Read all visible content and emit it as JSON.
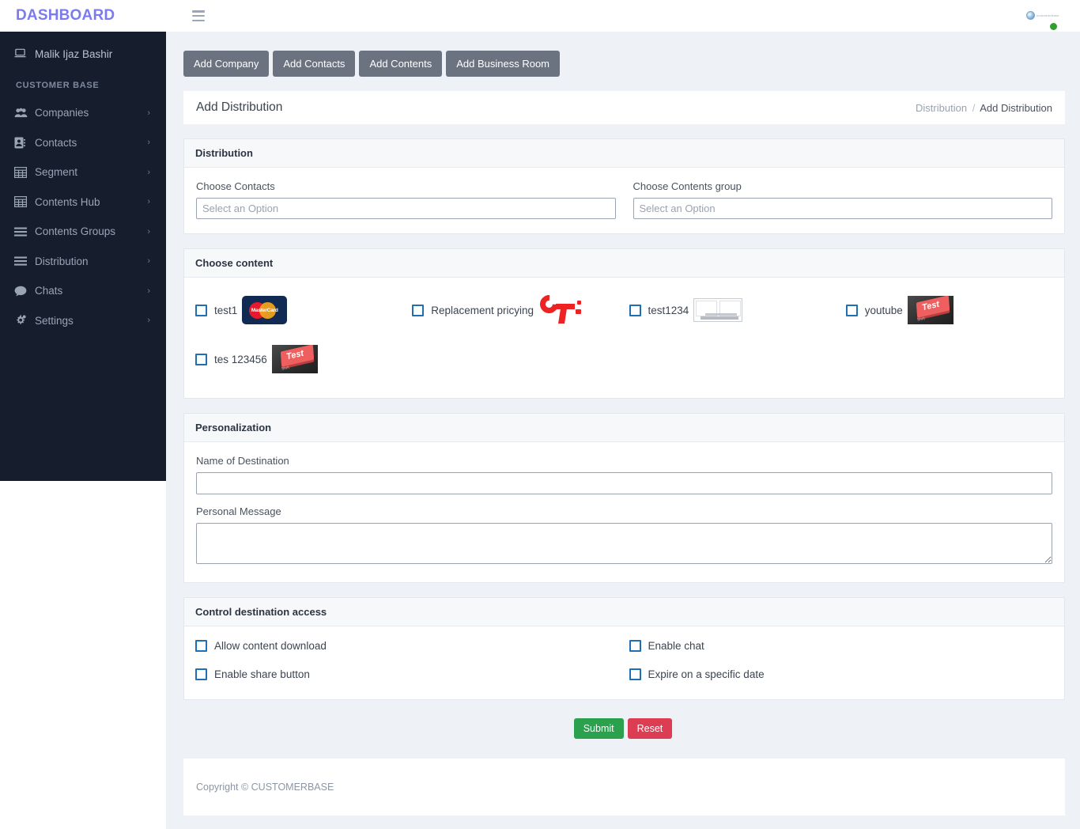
{
  "topbar": {
    "brand": "DASHBOARD",
    "menu_icon": "hamburger-icon",
    "logo_caption": "customerbase"
  },
  "sidebar": {
    "user_name": "Malik Ijaz Bashir",
    "user_icon": "laptop-icon",
    "section_label": "CUSTOMER BASE",
    "items": [
      {
        "label": "Companies",
        "icon": "users-group-icon",
        "chevron": "›"
      },
      {
        "label": "Contacts",
        "icon": "address-card-icon",
        "chevron": "›"
      },
      {
        "label": "Segment",
        "icon": "table-grid-icon",
        "chevron": "›"
      },
      {
        "label": "Contents Hub",
        "icon": "table-grid-icon",
        "chevron": "›"
      },
      {
        "label": "Contents Groups",
        "icon": "bars-icon",
        "chevron": "›"
      },
      {
        "label": "Distribution",
        "icon": "bars-icon",
        "chevron": "›"
      },
      {
        "label": "Chats",
        "icon": "comment-icon",
        "chevron": "›"
      },
      {
        "label": "Settings",
        "icon": "cogs-icon",
        "chevron": "›"
      }
    ]
  },
  "toolbar": {
    "buttons": [
      {
        "label": "Add Company"
      },
      {
        "label": "Add Contacts"
      },
      {
        "label": "Add Contents"
      },
      {
        "label": "Add Business Room"
      }
    ]
  },
  "page": {
    "title": "Add Distribution",
    "breadcrumb": {
      "parent": "Distribution",
      "separator": "/",
      "current": "Add Distribution"
    }
  },
  "distribution_panel": {
    "heading": "Distribution",
    "choose_contacts": {
      "label": "Choose Contacts",
      "value": "",
      "placeholder": "Select an Option"
    },
    "choose_contents_group": {
      "label": "Choose Contents group",
      "value": "",
      "placeholder": "Select an Option"
    }
  },
  "choose_content_panel": {
    "heading": "Choose content",
    "items": [
      {
        "label": "test1",
        "checked": false,
        "thumb": "mastercard-card-image"
      },
      {
        "label": "Replacement pricying",
        "checked": false,
        "thumb": "ct-red-logo-image"
      },
      {
        "label": "test1234",
        "checked": false,
        "thumb": "document-pages-image"
      },
      {
        "label": "youtube",
        "checked": false,
        "thumb": "keyboard-test-key-image"
      },
      {
        "label": "tes 123456",
        "checked": false,
        "thumb": "keyboard-test-key-image"
      }
    ]
  },
  "personalization_panel": {
    "heading": "Personalization",
    "name_of_destination": {
      "label": "Name of Destination",
      "value": "",
      "placeholder": ""
    },
    "personal_message": {
      "label": "Personal Message",
      "value": "",
      "placeholder": ""
    }
  },
  "access_panel": {
    "heading": "Control destination access",
    "options": [
      {
        "label": "Allow content download",
        "checked": false
      },
      {
        "label": "Enable chat",
        "checked": false
      },
      {
        "label": "Enable share button",
        "checked": false
      },
      {
        "label": "Expire on a specific date",
        "checked": false
      }
    ]
  },
  "actions": {
    "submit_label": "Submit",
    "reset_label": "Reset"
  },
  "footer": {
    "copyright": "Copyright © CUSTOMERBASE"
  },
  "colors": {
    "sidebar_bg": "#161e2e",
    "brand": "#7b7bf0",
    "content_bg": "#eef1f6",
    "toolbar_btn": "#6b7280",
    "submit": "#2ba14d",
    "reset": "#dc3d52",
    "checkbox_border": "#1f6fb5",
    "status_dot": "#2ea02e"
  }
}
